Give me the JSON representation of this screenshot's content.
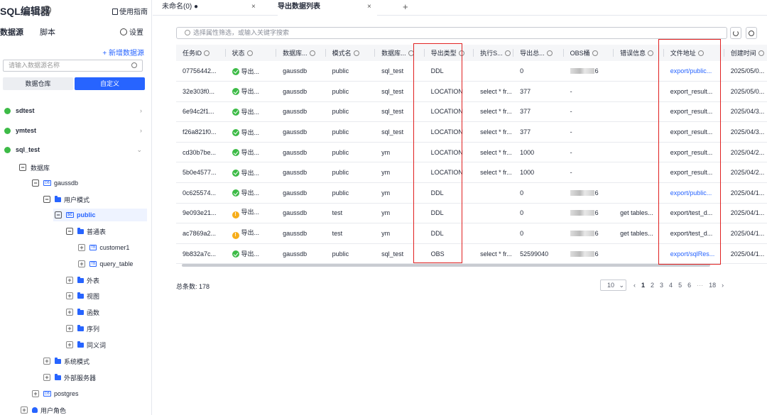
{
  "sidebar": {
    "title": "SQL编辑器",
    "help": "?",
    "guide": "使用指南",
    "tabs": [
      "数据源",
      "脚本"
    ],
    "settings": "设置",
    "new_datasource": "+ 新增数据源",
    "search_placeholder": "请输入数据源名称",
    "segments": [
      "数据仓库",
      "自定义"
    ],
    "datasources": [
      {
        "name": "sdtest",
        "chevron": "›"
      },
      {
        "name": "ymtest",
        "chevron": "›"
      },
      {
        "name": "sql_test",
        "chevron": "⌄"
      }
    ],
    "tree": {
      "warehouse": "数据库",
      "gaussdb": "gaussdb",
      "user_mode": "用户模式",
      "public": "public",
      "normal_tables": "普通表",
      "customer1": "customer1",
      "query_table": "query_table",
      "foreign_tables": "外表",
      "views": "视图",
      "functions": "函数",
      "sequences": "序列",
      "synonyms": "同义词",
      "system_mode": "系统模式",
      "external_servers": "外部服务器",
      "postgres": "postgres",
      "user_roles": "用户角色",
      "db_badge": "DB",
      "sc_badge": "SC",
      "tb_badge": "TB"
    }
  },
  "tabs": [
    {
      "label": "未命名(0) ●",
      "close": "×"
    },
    {
      "label": "导出数据列表",
      "close": "×"
    }
  ],
  "tab_add": "+",
  "filter_placeholder": "选择属性筛选，或输入关键字搜索",
  "table": {
    "headers": [
      "任务ID",
      "状态",
      "数据库...",
      "模式名",
      "数据库...",
      "导出类型",
      "执行S...",
      "导出总...",
      "OBS桶",
      "错误信息",
      "文件地址",
      "创建时间"
    ],
    "rows": [
      {
        "id": "07756442...",
        "status": "ok",
        "status_text": "导出...",
        "db": "gaussdb",
        "schema": "public",
        "dbname": "sql_test",
        "type": "DDL",
        "sql": "",
        "total": "0",
        "obs": "6",
        "obs_blur": true,
        "error": "",
        "file": "export/public...",
        "file_link": true,
        "created": "2025/05/0..."
      },
      {
        "id": "32e303f0...",
        "status": "ok",
        "status_text": "导出...",
        "db": "gaussdb",
        "schema": "public",
        "dbname": "sql_test",
        "type": "LOCATION",
        "sql": "select * fr...",
        "total": "377",
        "obs": "-",
        "obs_blur": false,
        "error": "",
        "file": "export_result...",
        "file_link": false,
        "created": "2025/05/0..."
      },
      {
        "id": "6e94c2f1...",
        "status": "ok",
        "status_text": "导出...",
        "db": "gaussdb",
        "schema": "public",
        "dbname": "sql_test",
        "type": "LOCATION",
        "sql": "select * fr...",
        "total": "377",
        "obs": "-",
        "obs_blur": false,
        "error": "",
        "file": "export_result...",
        "file_link": false,
        "created": "2025/04/3..."
      },
      {
        "id": "f26a821f0...",
        "status": "ok",
        "status_text": "导出...",
        "db": "gaussdb",
        "schema": "public",
        "dbname": "sql_test",
        "type": "LOCATION",
        "sql": "select * fr...",
        "total": "377",
        "obs": "-",
        "obs_blur": false,
        "error": "",
        "file": "export_result...",
        "file_link": false,
        "created": "2025/04/3..."
      },
      {
        "id": "cd30b7be...",
        "status": "ok",
        "status_text": "导出...",
        "db": "gaussdb",
        "schema": "public",
        "dbname": "ym",
        "type": "LOCATION",
        "sql": "select * fr...",
        "total": "1000",
        "obs": "-",
        "obs_blur": false,
        "error": "",
        "file": "export_result...",
        "file_link": false,
        "created": "2025/04/2..."
      },
      {
        "id": "5b0e4577...",
        "status": "ok",
        "status_text": "导出...",
        "db": "gaussdb",
        "schema": "public",
        "dbname": "ym",
        "type": "LOCATION",
        "sql": "select * fr...",
        "total": "1000",
        "obs": "-",
        "obs_blur": false,
        "error": "",
        "file": "export_result...",
        "file_link": false,
        "created": "2025/04/2..."
      },
      {
        "id": "0c625574...",
        "status": "ok",
        "status_text": "导出...",
        "db": "gaussdb",
        "schema": "public",
        "dbname": "ym",
        "type": "DDL",
        "sql": "",
        "total": "0",
        "obs": "6",
        "obs_blur": true,
        "error": "",
        "file": "export/public...",
        "file_link": true,
        "created": "2025/04/1..."
      },
      {
        "id": "9e093e21...",
        "status": "warn",
        "status_text": "导出...",
        "db": "gaussdb",
        "schema": "test",
        "dbname": "ym",
        "type": "DDL",
        "sql": "",
        "total": "0",
        "obs": "6",
        "obs_blur": true,
        "error": "get tables...",
        "file": "export/test_d...",
        "file_link": false,
        "created": "2025/04/1..."
      },
      {
        "id": "ac7869a2...",
        "status": "warn",
        "status_text": "导出...",
        "db": "gaussdb",
        "schema": "test",
        "dbname": "ym",
        "type": "DDL",
        "sql": "",
        "total": "0",
        "obs": "6",
        "obs_blur": true,
        "error": "get tables...",
        "file": "export/test_d...",
        "file_link": false,
        "created": "2025/04/1..."
      },
      {
        "id": "9b832a7c...",
        "status": "ok",
        "status_text": "导出...",
        "db": "gaussdb",
        "schema": "public",
        "dbname": "sql_test",
        "type": "OBS",
        "sql": "select * fr...",
        "total": "52599040",
        "obs": "6",
        "obs_blur": true,
        "error": "",
        "file": "export/sqlRes...",
        "file_link": true,
        "created": "2025/04/1..."
      }
    ]
  },
  "total_label": "总条数: 178",
  "pager": {
    "page_size": "10",
    "prev": "‹",
    "pages": [
      "1",
      "2",
      "3",
      "4",
      "5",
      "6",
      "···",
      "18"
    ],
    "next": "›"
  },
  "colors": {
    "accent": "#2764ff",
    "success": "#3dbb47",
    "warning": "#f6ad1a",
    "highlight_box": "#e02020"
  }
}
